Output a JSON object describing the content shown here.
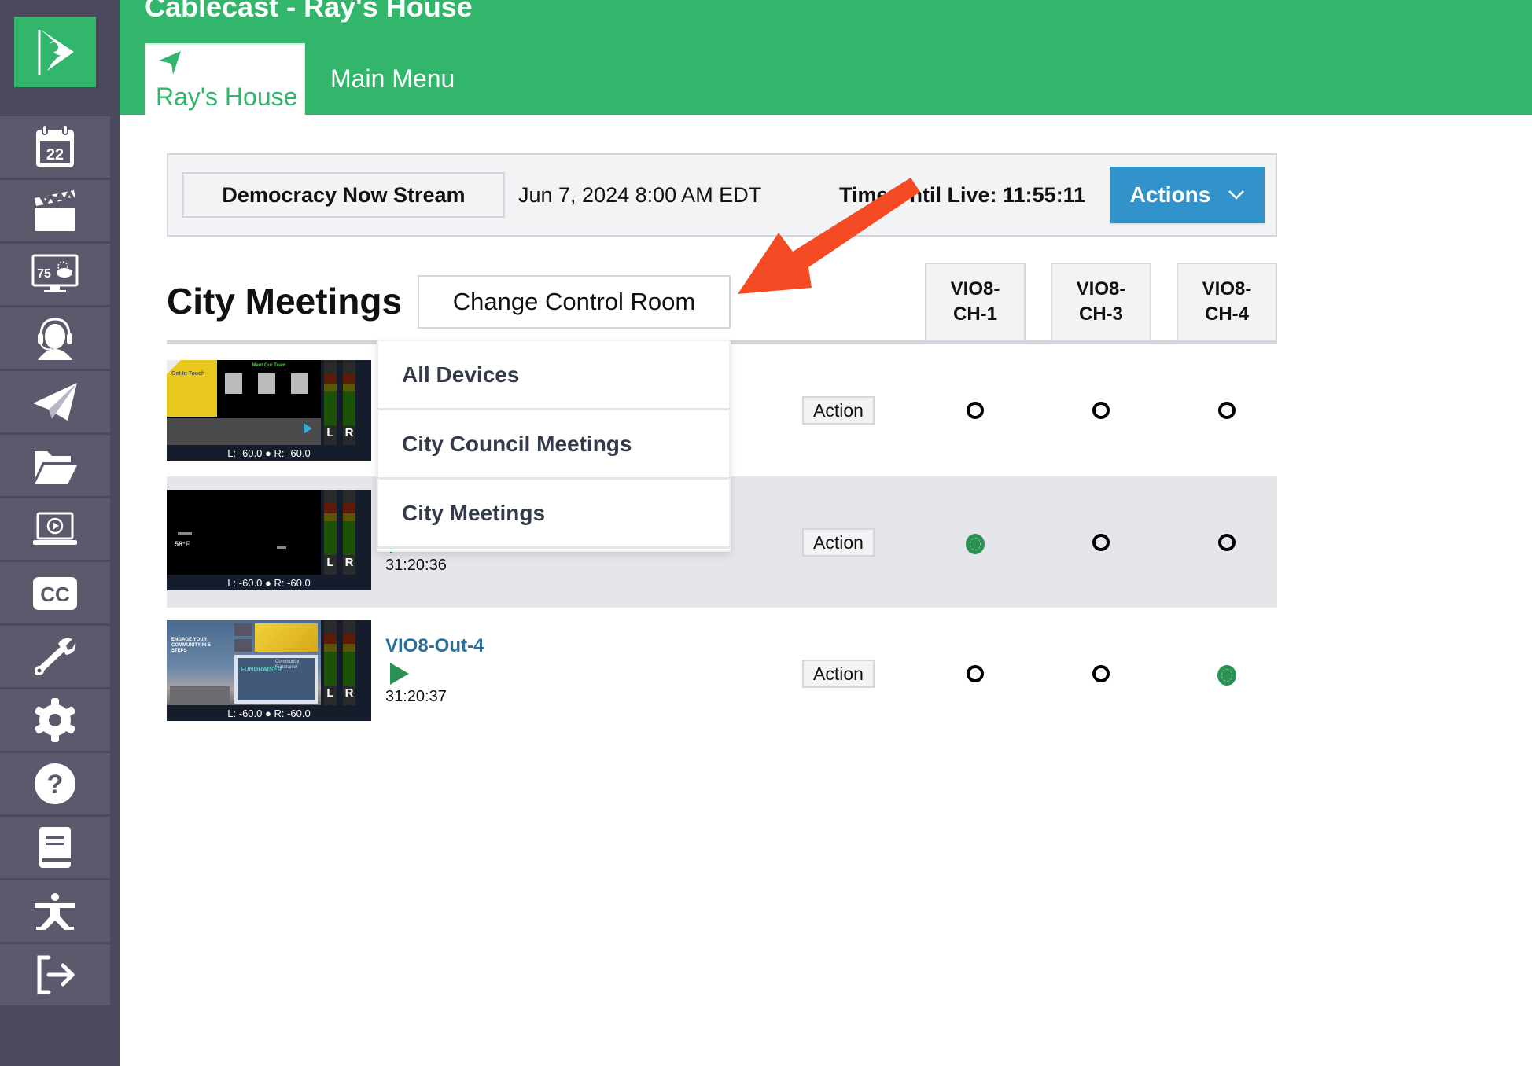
{
  "header": {
    "app_title": "Cablecast - Ray's House",
    "active_tab": "Ray's House",
    "main_menu": "Main Menu",
    "brand_color": "#32b66b"
  },
  "sidebar": {
    "logo": "cablecast-logo-icon",
    "items": [
      {
        "icon": "calendar-icon",
        "label": "22"
      },
      {
        "icon": "clapperboard-icon"
      },
      {
        "icon": "weather-display-icon",
        "label": "75"
      },
      {
        "icon": "headset-support-icon"
      },
      {
        "icon": "paper-plane-icon"
      },
      {
        "icon": "folder-open-icon"
      },
      {
        "icon": "laptop-play-icon"
      },
      {
        "icon": "closed-captions-icon",
        "label": "CC"
      },
      {
        "icon": "wrench-icon"
      },
      {
        "icon": "gear-icon"
      },
      {
        "icon": "help-icon",
        "label": "?"
      },
      {
        "icon": "book-icon"
      },
      {
        "icon": "yoga-pose-icon"
      },
      {
        "icon": "sign-out-icon"
      }
    ]
  },
  "stream_bar": {
    "name": "Democracy Now Stream",
    "datetime": "Jun 7, 2024 8:00 AM EDT",
    "countdown_label": "Time Until Live: 11:55:11",
    "actions_label": "Actions",
    "actions_color": "#3193c9"
  },
  "section": {
    "title": "City Meetings",
    "change_room_label": "Change Control Room"
  },
  "columns": [
    "VIO8-CH-1",
    "VIO8-CH-3",
    "VIO8-CH-4"
  ],
  "columns_display": [
    {
      "line1": "VIO8-",
      "line2": "CH-1"
    },
    {
      "line1": "VIO8-",
      "line2": "CH-3"
    },
    {
      "line1": "VIO8-",
      "line2": "CH-4"
    }
  ],
  "rows": [
    {
      "title": "",
      "time": "",
      "levels": "L: -60.0 ● R: -60.0",
      "meter_left": "L",
      "meter_right": "R",
      "action_label": "Action",
      "routes": [
        false,
        false,
        false
      ]
    },
    {
      "title": "",
      "time": "31:20:36",
      "levels": "L: -60.0 ● R: -60.0",
      "meter_left": "L",
      "meter_right": "R",
      "action_label": "Action",
      "routes": [
        true,
        false,
        false
      ]
    },
    {
      "title": "VIO8-Out-4",
      "time": "31:20:37",
      "levels": "L: -60.0 ● R: -60.0",
      "meter_left": "L",
      "meter_right": "R",
      "action_label": "Action",
      "routes": [
        false,
        false,
        true
      ]
    }
  ],
  "thumbnails": {
    "row0": {
      "left_panel_title": "Get In Touch",
      "right_panel_title": "Meet Our Team"
    },
    "row1": {
      "weather_text": "58°F"
    },
    "row2": {
      "headline": "ENGAGE YOUR COMMUNITY IN 5 STEPS",
      "card_title": "Community Fundraiser",
      "heart_text": "FUNDRAISER"
    }
  },
  "dropdown": {
    "items": [
      "All Devices",
      "City Council Meetings",
      "City Meetings",
      ""
    ]
  },
  "annotation": {
    "type": "arrow",
    "color": "#f44b25",
    "points_to": "change-control-room-button"
  },
  "route_active_color": "#2a9152"
}
